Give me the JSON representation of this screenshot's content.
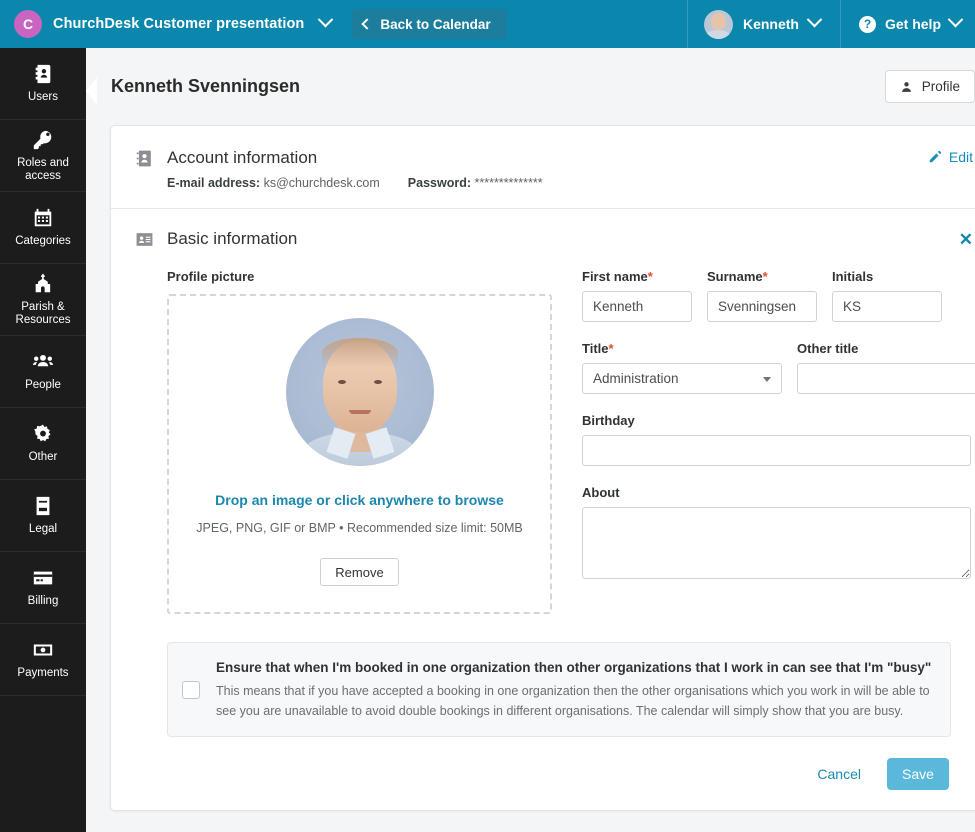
{
  "topbar": {
    "org_initial": "C",
    "org_name": "ChurchDesk Customer presentation",
    "back_label": "Back to Calendar",
    "user_name": "Kenneth",
    "help_label": "Get help",
    "accent": "#0b87ad",
    "org_avatar_color": "#c964c0"
  },
  "sidebar": {
    "items": [
      {
        "label": "Users",
        "icon": "contact-book-icon"
      },
      {
        "label": "Roles and access",
        "icon": "key-icon"
      },
      {
        "label": "Categories",
        "icon": "calendar-icon"
      },
      {
        "label": "Parish & Resources",
        "icon": "church-icon"
      },
      {
        "label": "People",
        "icon": "people-icon"
      },
      {
        "label": "Other",
        "icon": "gear-icon"
      },
      {
        "label": "Legal",
        "icon": "document-icon"
      },
      {
        "label": "Billing",
        "icon": "credit-card-icon"
      },
      {
        "label": "Payments",
        "icon": "banknote-icon"
      }
    ]
  },
  "page": {
    "title": "Kenneth Svenningsen",
    "profile_button": "Profile"
  },
  "account": {
    "title": "Account information",
    "email_label": "E-mail address:",
    "email_value": "ks@churchdesk.com",
    "password_label": "Password:",
    "password_value": "**************",
    "edit_label": "Edit"
  },
  "basic": {
    "title": "Basic information",
    "close_icon": "close-icon",
    "profile_picture_label": "Profile picture",
    "dropzone_main": "Drop an image or click anywhere to browse",
    "dropzone_sub": "JPEG, PNG, GIF or BMP • Recommended size limit: 50MB",
    "remove_label": "Remove",
    "fields": {
      "first_name_label": "First name",
      "first_name_value": "Kenneth",
      "surname_label": "Surname",
      "surname_value": "Svenningsen",
      "initials_label": "Initials",
      "initials_value": "KS",
      "title_label": "Title",
      "title_value": "Administration",
      "other_title_label": "Other title",
      "other_title_value": "",
      "birthday_label": "Birthday",
      "birthday_value": "",
      "about_label": "About",
      "about_value": "",
      "required_marker": "*"
    }
  },
  "busy": {
    "title": "Ensure that when I'm booked in one organization then other organizations that I work in can see that I'm \"busy\"",
    "description": "This means that if you have accepted a booking in one organization then the other organisations which you work in will be able to see you are unavailable to avoid double bookings in different organisations. The calendar will simply show that you are busy.",
    "checked": false
  },
  "footer": {
    "cancel_label": "Cancel",
    "save_label": "Save",
    "save_color": "#5ab9da"
  }
}
